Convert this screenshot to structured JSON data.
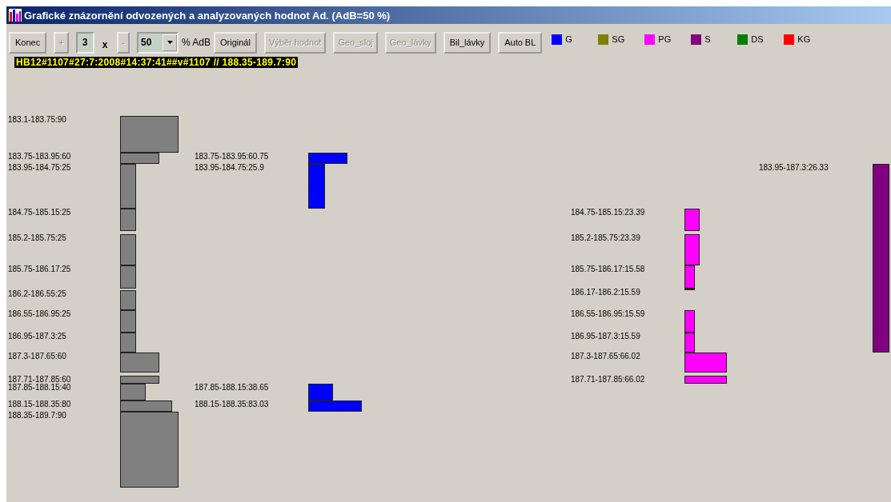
{
  "window": {
    "title": "Grafické znázornění odvozených a analyzovaných hodnot Ad.  (AdB=50 %)"
  },
  "toolbar": [
    {
      "kind": "button",
      "label": "Konec",
      "disabled": false
    },
    {
      "kind": "button",
      "label": "+",
      "disabled": true
    },
    {
      "kind": "field",
      "value": "3"
    },
    {
      "kind": "text",
      "label": "x"
    },
    {
      "kind": "button",
      "label": "-",
      "disabled": true
    },
    {
      "kind": "dropdown",
      "value": "50"
    },
    {
      "kind": "text",
      "label": "% AdB"
    },
    {
      "kind": "button",
      "label": "Originál",
      "disabled": false
    },
    {
      "kind": "button",
      "label": "Výběr hodnot",
      "disabled": true
    },
    {
      "kind": "button",
      "label": "Geo_sloj",
      "disabled": true
    },
    {
      "kind": "button",
      "label": "Geo_lávky",
      "disabled": true
    },
    {
      "kind": "button",
      "label": "Bil_lávky",
      "disabled": false
    },
    {
      "kind": "button",
      "label": "Auto BL",
      "disabled": false
    }
  ],
  "legend": [
    {
      "label": "G",
      "color": "#0000ff"
    },
    {
      "label": "SG",
      "color": "#808000"
    },
    {
      "label": "PG",
      "color": "#ff00ff"
    },
    {
      "label": "S",
      "color": "#800080"
    },
    {
      "label": "DS",
      "color": "#008000"
    },
    {
      "label": "KG",
      "color": "#ff0000"
    }
  ],
  "info_line": "HB12#1107#27:7:2008#14:37:41##v#1107 // 188.35-189.7:90",
  "diagram": {
    "columns": [
      {
        "color": "#808080",
        "intervals": [
          {
            "label": "183.1-183.75:90"
          },
          {
            "label": "183.75-183.95:60"
          },
          {
            "label": "183.95-184.75:25"
          },
          {
            "label": "184.75-185.15:25"
          },
          {
            "label": "185.2-185.75:25"
          },
          {
            "label": "185.75-186.17:25"
          },
          {
            "label": "186.2-186.55:25"
          },
          {
            "label": "186.55-186.95:25"
          },
          {
            "label": "186.95-187.3:25"
          },
          {
            "label": "187.3-187.65:60"
          },
          {
            "label": "187.71-187.85:60"
          },
          {
            "label": "187.85-188.15:40"
          },
          {
            "label": "188.15-188.35:80"
          },
          {
            "label": "188.35-189.7:90"
          }
        ]
      },
      {
        "color": "#0000ff",
        "intervals": [
          {
            "label": "183.75-183.95:60.75"
          },
          {
            "label": "183.95-184.75:25.9"
          },
          {
            "label": "187.85-188.15:38.65"
          },
          {
            "label": "188.15-188.35:83.03"
          }
        ]
      },
      {
        "color": "#ff00ff",
        "intervals": [
          {
            "label": "184.75-185.15:23.39"
          },
          {
            "label": "185.2-185.75:23.39"
          },
          {
            "label": "185.75-186.17:15.58"
          },
          {
            "label": "186.17-186.2:15.59"
          },
          {
            "label": "186.55-186.95:15.59"
          },
          {
            "label": "186.95-187.3:15.59"
          },
          {
            "label": "187.3-187.65:66.02"
          },
          {
            "label": "187.71-187.85:66.02"
          }
        ]
      },
      {
        "color": "#800080",
        "intervals": [
          {
            "label": "183.95-187.3:26.33"
          }
        ]
      }
    ]
  }
}
